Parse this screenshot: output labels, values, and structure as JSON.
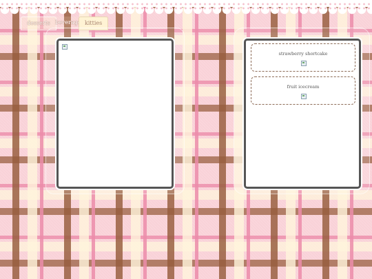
{
  "tabs": [
    {
      "label": "desserts"
    },
    {
      "label": "beverages"
    },
    {
      "label": "kitties"
    }
  ],
  "right_panel": {
    "items": [
      {
        "label": "strawberry shortcake"
      },
      {
        "label": "fruit icecream"
      }
    ]
  },
  "colors": {
    "panel_border": "#555555",
    "tab_active_bg": "#fff3d4",
    "plaid_pink": "#f9d2d8",
    "plaid_brown": "#965c3c"
  }
}
